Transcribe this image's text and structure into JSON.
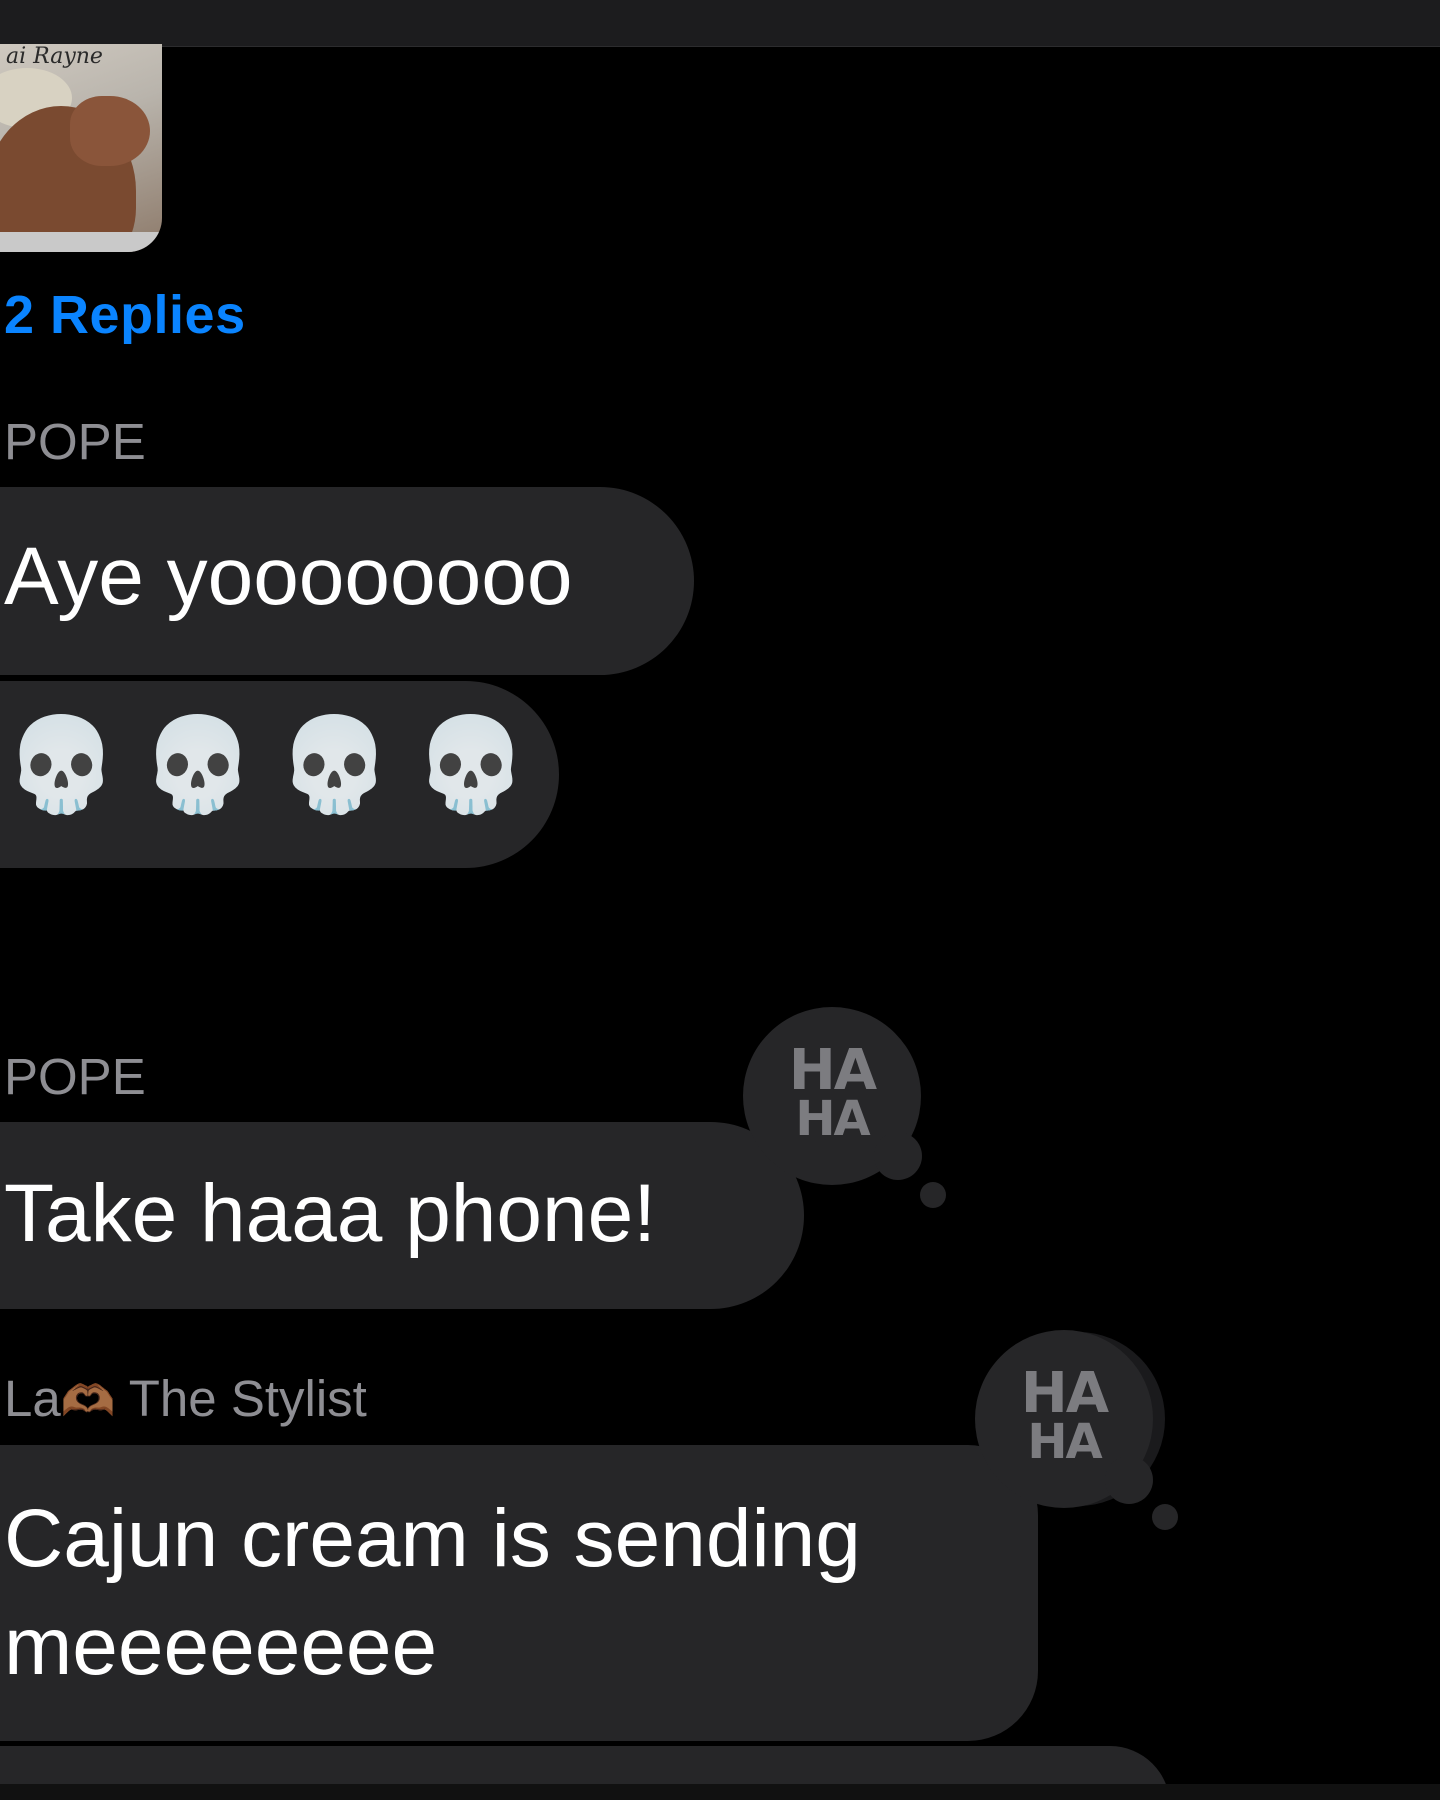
{
  "thread": {
    "attachment": {
      "caption": "ai Rayne",
      "alt": "photo attachment thumbnail"
    },
    "replies_label": "2 Replies"
  },
  "messages": [
    {
      "sender": "POPE",
      "bubbles": [
        "Aye yoooooooo",
        "💀💀💀💀"
      ]
    },
    {
      "sender": "POPE",
      "bubbles": [
        "Take haaa phone!"
      ],
      "tapback": "HA HA"
    },
    {
      "sender": "La🫶🏾 The Stylist",
      "sender_parts": {
        "prefix": "La",
        "emoji": "🫶🏾",
        "suffix": " The Stylist"
      },
      "bubbles": [
        "Cajun cream is sending\nmeeeeeeee"
      ],
      "tapback": "HA HA"
    }
  ],
  "tapback_label_line1": "HA",
  "tapback_label_line2": "HA",
  "skulls": [
    "💀",
    "💀",
    "💀",
    "💀"
  ],
  "colors": {
    "background": "#000000",
    "bubble": "#262628",
    "link": "#0a84ff",
    "sender": "#8e8e93",
    "text": "#ffffff"
  }
}
